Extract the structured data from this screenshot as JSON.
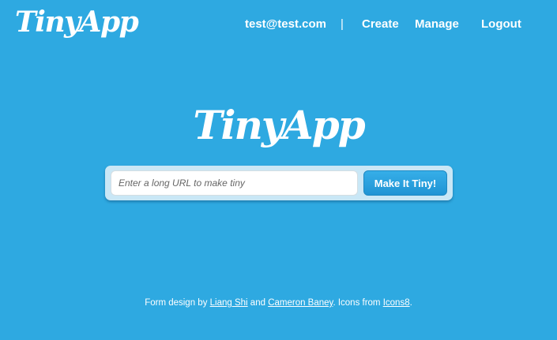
{
  "header": {
    "brand": "TinyApp",
    "nav": {
      "email": "test@test.com",
      "separator": "|",
      "create": "Create",
      "manage": "Manage",
      "logout": "Logout"
    }
  },
  "hero": {
    "logo": "TinyApp"
  },
  "form": {
    "input_placeholder": "Enter a long URL to make tiny",
    "input_value": "",
    "submit_label": "Make It Tiny!"
  },
  "footer": {
    "prefix": "Form design by ",
    "author1": "Liang Shi",
    "and": " and ",
    "author2": "Cameron Baney",
    "icons_text": ". Icons from ",
    "icons_link": "Icons8",
    "suffix": "."
  },
  "colors": {
    "background": "#2ea9e1",
    "button": "#1f94d4",
    "form_panel": "#c9e7f6"
  }
}
